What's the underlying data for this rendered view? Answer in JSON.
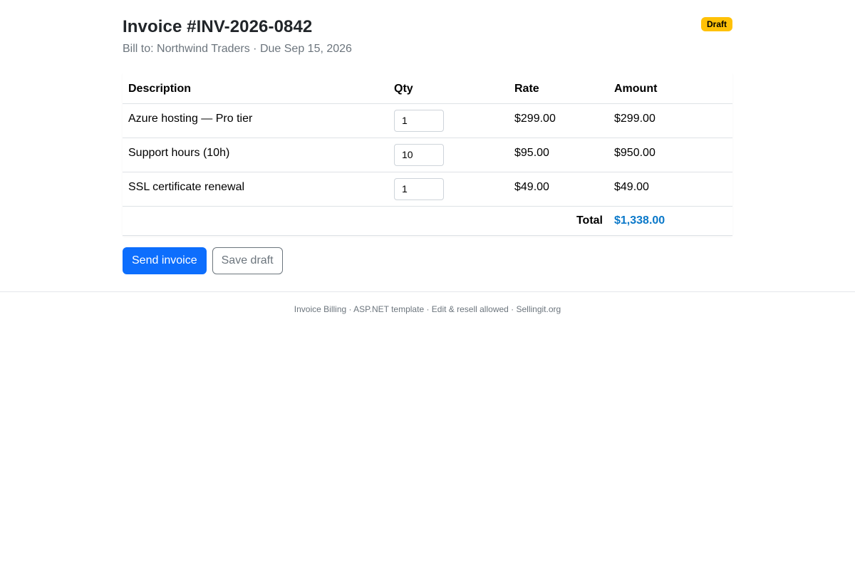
{
  "invoice": {
    "title": "Invoice #INV-2026-0842",
    "bill_to": "Bill to: Northwind Traders · Due Sep 15, 2026",
    "status_badge": "Draft"
  },
  "table": {
    "headers": {
      "description": "Description",
      "qty": "Qty",
      "rate": "Rate",
      "amount": "Amount"
    },
    "rows": [
      {
        "description": "Azure hosting — Pro tier",
        "qty": "1",
        "rate": "$299.00",
        "amount": "$299.00"
      },
      {
        "description": "Support hours (10h)",
        "qty": "10",
        "rate": "$95.00",
        "amount": "$950.00"
      },
      {
        "description": "SSL certificate renewal",
        "qty": "1",
        "rate": "$49.00",
        "amount": "$49.00"
      }
    ],
    "total_label": "Total",
    "total_value": "$1,338.00"
  },
  "actions": {
    "send_label": "Send invoice",
    "save_label": "Save draft"
  },
  "footer": {
    "text": "Invoice Billing · ASP.NET template · Edit & resell allowed · Sellingit.org"
  },
  "colors": {
    "primary": "#0d6efd",
    "badge": "#ffc107",
    "total": "#0a78c9",
    "muted": "#6c757d"
  }
}
